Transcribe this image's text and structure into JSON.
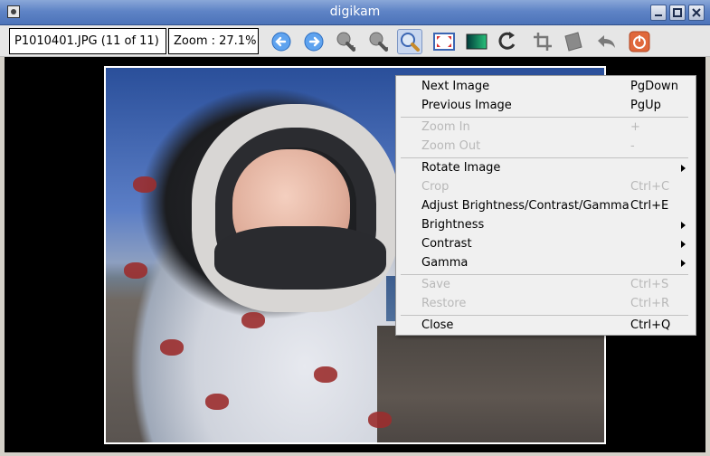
{
  "window": {
    "title": "digikam",
    "buttons": [
      "minimize",
      "maximize",
      "close"
    ]
  },
  "toolbar": {
    "file_info": "P1010401.JPG (11 of 11)",
    "zoom_info": "Zoom : 27.1%",
    "tools": [
      {
        "name": "previous-image",
        "icon": "arrow-left-icon"
      },
      {
        "name": "next-image",
        "icon": "arrow-right-icon"
      },
      {
        "name": "zoom-in",
        "icon": "zoom-in-icon"
      },
      {
        "name": "zoom-out",
        "icon": "zoom-out-icon"
      },
      {
        "name": "zoom-autofit",
        "icon": "magnifier-icon",
        "active": true
      },
      {
        "name": "fullscreen",
        "icon": "fullscreen-icon"
      },
      {
        "name": "adjust-colors",
        "icon": "color-gradient-icon"
      },
      {
        "name": "rotate",
        "icon": "rotate-icon"
      },
      {
        "name": "crop",
        "icon": "crop-icon"
      },
      {
        "name": "shear",
        "icon": "shear-icon"
      },
      {
        "name": "undo",
        "icon": "undo-icon"
      },
      {
        "name": "close",
        "icon": "power-icon"
      }
    ]
  },
  "colors": {
    "titlebar": "#5f84c6",
    "menu_bg": "#f0f0f0",
    "disabled_text": "#b8b8b8",
    "close_button": "#e0683c"
  },
  "context_menu": {
    "items": [
      {
        "label": "Next Image",
        "shortcut": "PgDown",
        "enabled": true
      },
      {
        "label": "Previous Image",
        "shortcut": "PgUp",
        "enabled": true
      },
      {
        "label": "Zoom In",
        "shortcut": "+",
        "enabled": false
      },
      {
        "label": "Zoom Out",
        "shortcut": "-",
        "enabled": false
      },
      {
        "label": "Rotate Image",
        "shortcut": "",
        "enabled": true,
        "submenu": true
      },
      {
        "label": "Crop",
        "shortcut": "Ctrl+C",
        "enabled": false
      },
      {
        "label": "Adjust Brightness/Contrast/Gamma",
        "shortcut": "Ctrl+E",
        "enabled": true
      },
      {
        "label": "Brightness",
        "shortcut": "",
        "enabled": true,
        "submenu": true
      },
      {
        "label": "Contrast",
        "shortcut": "",
        "enabled": true,
        "submenu": true
      },
      {
        "label": "Gamma",
        "shortcut": "",
        "enabled": true,
        "submenu": true
      },
      {
        "label": "Save",
        "shortcut": "Ctrl+S",
        "enabled": false
      },
      {
        "label": "Restore",
        "shortcut": "Ctrl+R",
        "enabled": false
      },
      {
        "label": "Close",
        "shortcut": "Ctrl+Q",
        "enabled": true
      }
    ]
  }
}
